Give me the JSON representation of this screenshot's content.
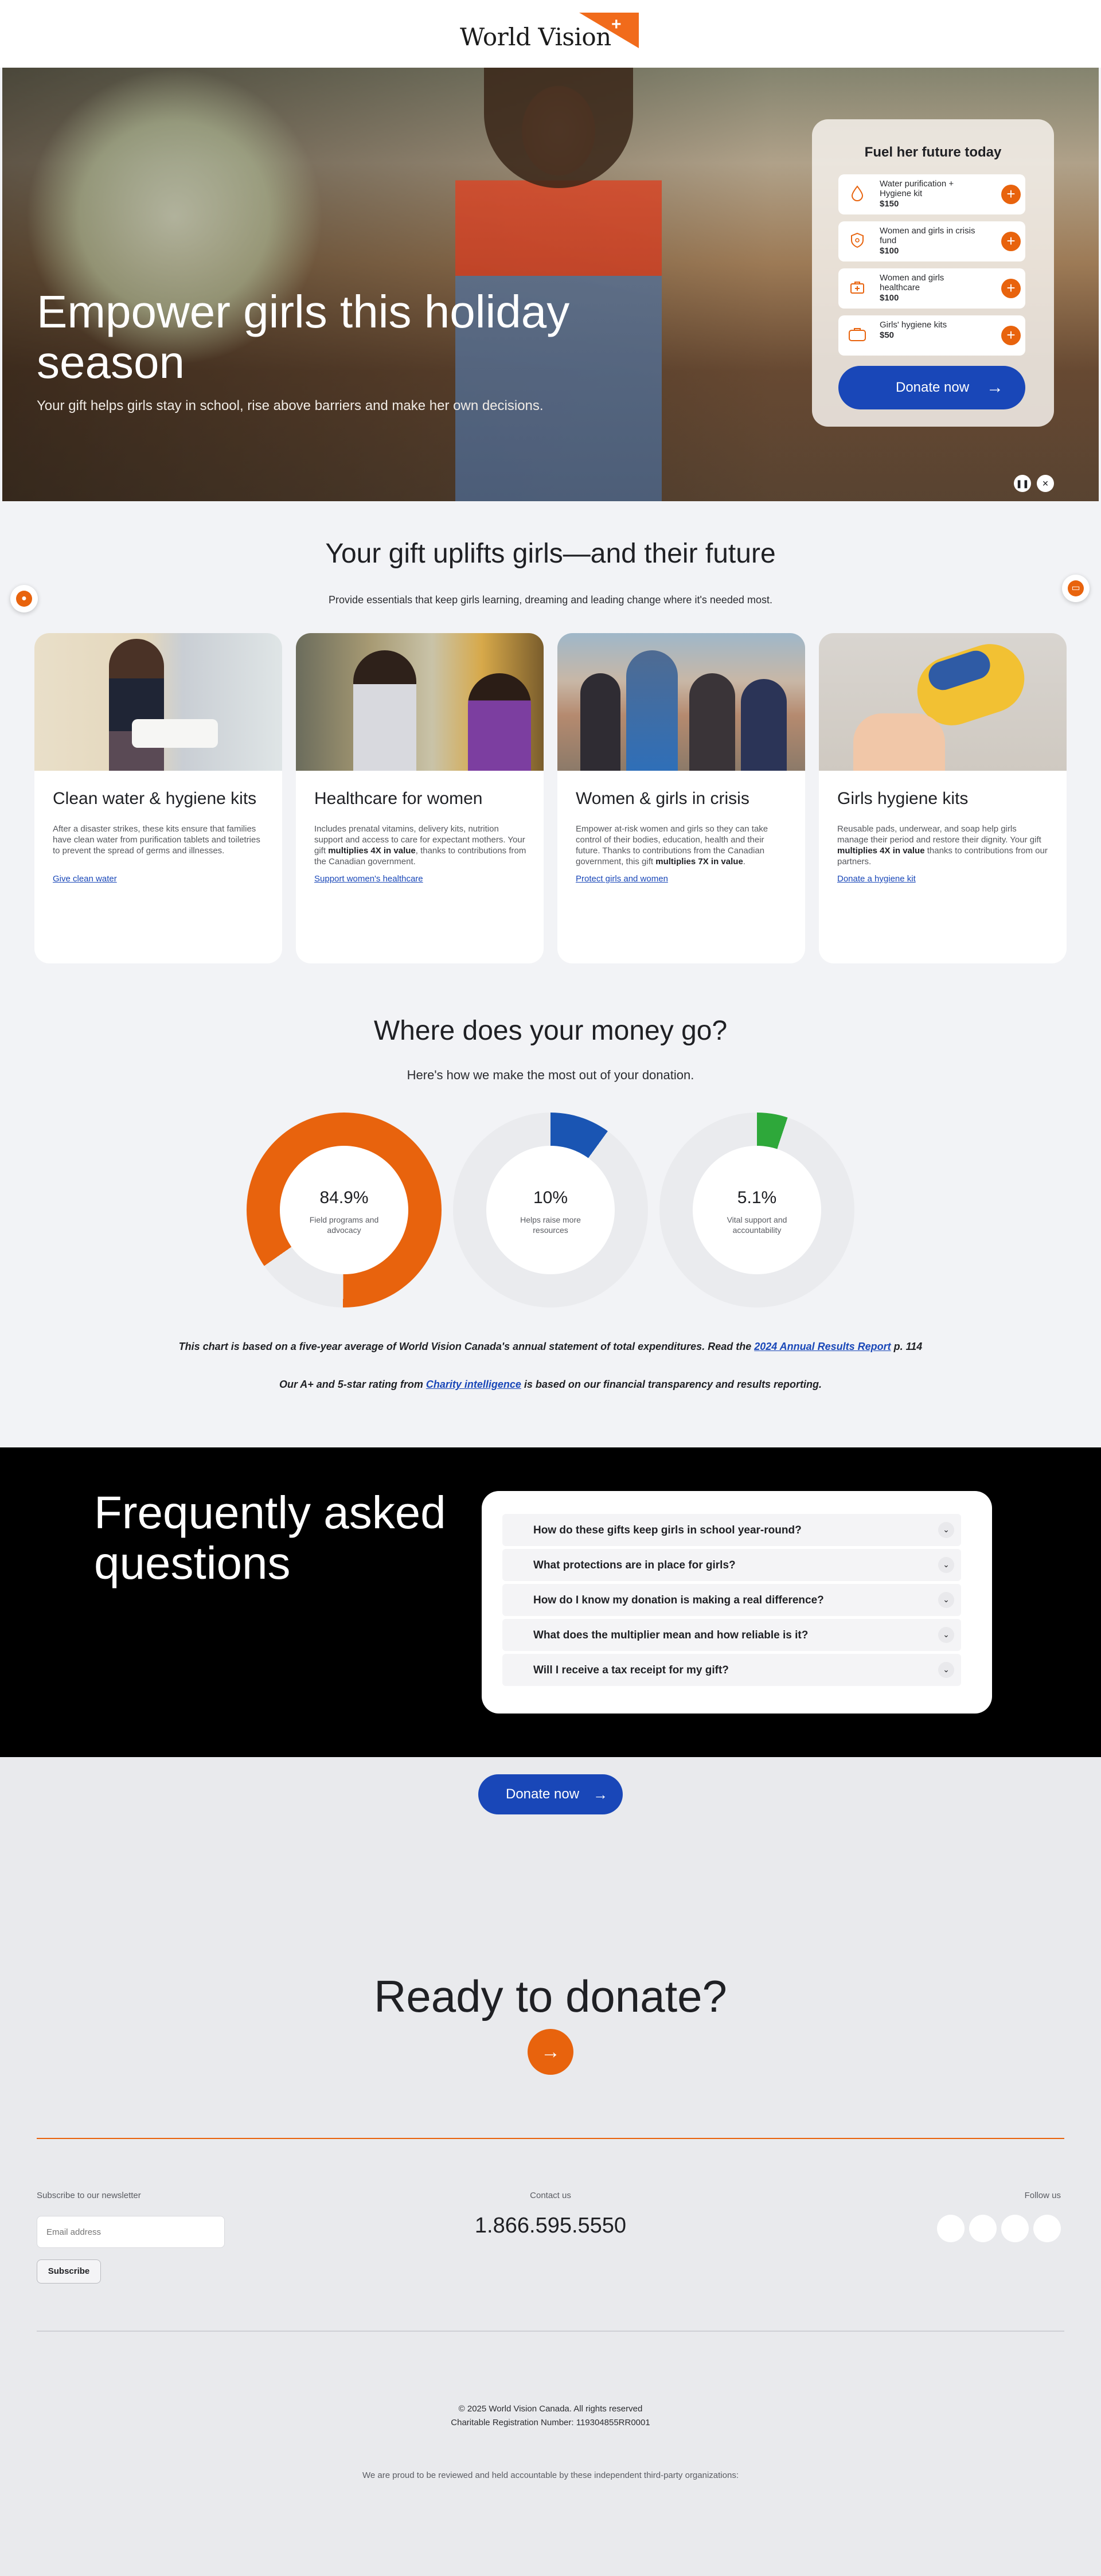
{
  "header": {
    "logo_text": "World Vision"
  },
  "hero": {
    "title": "Empower girls this holiday season",
    "subtitle": "Your gift helps girls stay in school, rise above barriers and make her own decisions.",
    "card": {
      "title": "Fuel her future today",
      "items": [
        {
          "label": "Water purification + Hygiene kit",
          "price": "$150",
          "icon": "water-drop-icon"
        },
        {
          "label": "Women and girls in crisis fund",
          "price": "$100",
          "icon": "shield-heart-icon"
        },
        {
          "label": "Women and girls healthcare",
          "price": "$100",
          "icon": "medical-kit-icon"
        },
        {
          "label": "Girls' hygiene kits",
          "price": "$50",
          "icon": "hygiene-bag-icon"
        }
      ],
      "donate_label": "Donate now"
    }
  },
  "gifts": {
    "title": "Your gift uplifts girls—and their future",
    "subtitle": "Provide essentials that keep girls learning, dreaming and leading change where it's needed most.",
    "cards": [
      {
        "title": "Clean water & hygiene kits",
        "desc": "After a disaster strikes, these kits ensure that families have clean water from purification tablets and toiletries to prevent the spread of germs and illnesses.",
        "desc_pre": "",
        "bold": "",
        "desc_post": "",
        "link": "Give clean water"
      },
      {
        "title": "Healthcare for women",
        "desc": "",
        "desc_pre": "Includes prenatal vitamins, delivery kits, nutrition support and access to care for expectant mothers. Your gift ",
        "bold": "multiplies 4X in value",
        "desc_post": ", thanks to contributions from the Canadian government.",
        "link": "Support women's healthcare"
      },
      {
        "title": "Women & girls in crisis",
        "desc": "",
        "desc_pre": "Empower at-risk women and girls so they can take control of their bodies, education, health and their future. Thanks to contributions from the Canadian government, this gift ",
        "bold": "multiplies 7X in value",
        "desc_post": ".",
        "link": "Protect girls and women"
      },
      {
        "title": "Girls hygiene kits",
        "desc": "",
        "desc_pre": "Reusable pads, underwear, and soap help girls manage their period and restore their dignity. Your gift ",
        "bold": "multiplies 4X in value",
        "desc_post": " thanks to contributions from our partners.",
        "link": "Donate a hygiene kit"
      }
    ]
  },
  "money": {
    "title": "Where does your money go?",
    "subtitle": "Here's how we make the most out of your donation.",
    "note1_pre": "This chart is based on a five-year average of World Vision Canada's annual statement of total expenditures. Read the ",
    "note1_link": "2024 Annual Results Report",
    "note1_post": " p. 114",
    "note2_pre": "Our A+ and 5-star rating from ",
    "note2_link": "Charity intelligence",
    "note2_post": " is based on our financial transparency and results reporting."
  },
  "chart_data": {
    "type": "pie",
    "series": [
      {
        "value": 84.9,
        "display": "84.9%",
        "label": "Field programs and advocacy",
        "color": "#e8630d"
      },
      {
        "value": 10,
        "display": "10%",
        "label": "Helps raise more resources",
        "color": "#1a55b3"
      },
      {
        "value": 5.1,
        "display": "5.1%",
        "label": "Vital support and accountability",
        "color": "#2ea83a"
      }
    ],
    "track_color": "#eaebee"
  },
  "faq": {
    "title": "Frequently asked questions",
    "items": [
      "How do these gifts keep girls in school year-round?",
      "What protections are in place for girls?",
      "How do I know my donation is making a real difference?",
      "What does the multiplier mean and how reliable is it?",
      "Will I receive a tax receipt for my gift?"
    ]
  },
  "cta": {
    "donate_label": "Donate now",
    "ready_title": "Ready to donate?"
  },
  "footer": {
    "newsletter_label": "Subscribe to our newsletter",
    "email_placeholder": "Email address",
    "subscribe_label": "Subscribe",
    "contact_label": "Contact us",
    "phone": "1.866.595.5550",
    "follow_label": "Follow us",
    "copyright": "© 2025 World Vision Canada. All rights reserved",
    "registration": "Charitable Registration Number: 119304855RR0001",
    "reviewed": "We are proud to be reviewed and held accountable by these independent third-party organizations:"
  }
}
